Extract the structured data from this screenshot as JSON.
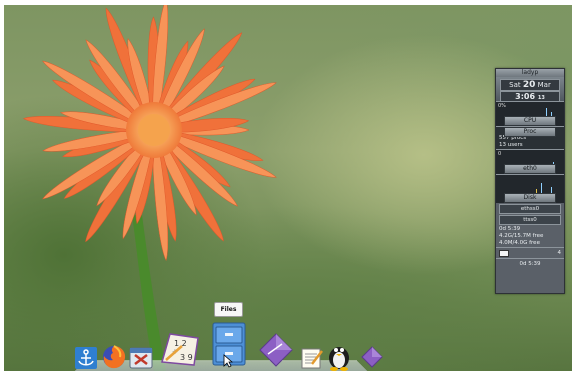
{
  "tooltip": {
    "text": "Files"
  },
  "dock": {
    "items": [
      {
        "name": "anchor-app",
        "icon": "anchor-icon"
      },
      {
        "name": "firefox",
        "icon": "firefox-icon"
      },
      {
        "name": "system-tools",
        "icon": "tools-icon"
      },
      {
        "name": "calculator-notepad",
        "icon": "calculator-icon"
      },
      {
        "name": "files",
        "icon": "filing-cabinet-icon"
      },
      {
        "name": "purple-diamond-app",
        "icon": "diamond-icon"
      },
      {
        "name": "text-editor",
        "icon": "notepad-icon"
      },
      {
        "name": "linux",
        "icon": "tux-icon"
      },
      {
        "name": "purple-diamond-app-2",
        "icon": "diamond-icon"
      }
    ]
  },
  "monitor": {
    "hostname": "ladyp",
    "date_prefix": "Sat",
    "date_day": "20",
    "date_month": "Mar",
    "time": "3:06",
    "seconds": "13",
    "cpu_percent": "0%",
    "cpu_label": "CPU",
    "proc_label": "Proc",
    "processes": "557 procs",
    "users": "13 users",
    "net_label": "eth0",
    "net_percent": "0",
    "disk_label": "Disk",
    "rows": [
      "ethss0",
      "ttss0"
    ],
    "uptime": "0d 5:39",
    "mem_free": "4.2G/15.7M free",
    "swap": "4.0M/4.0G free",
    "mail": "4",
    "footer": "0d 5:39"
  }
}
